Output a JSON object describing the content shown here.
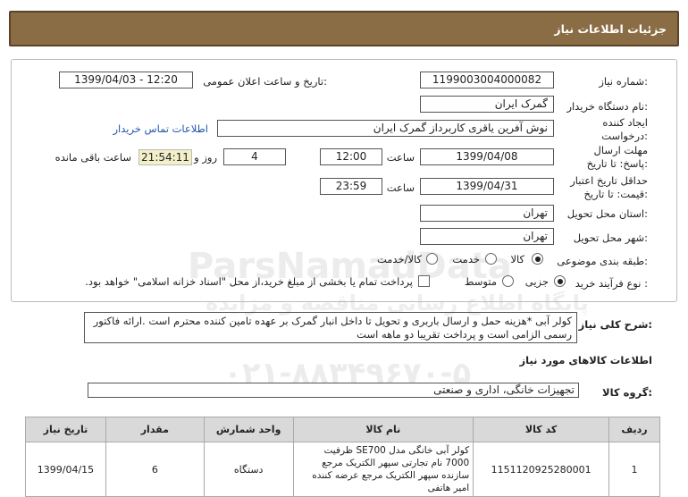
{
  "header": {
    "title": "جزئیات اطلاعات نیاز"
  },
  "fields": {
    "need_number_label": "شماره نیاز:",
    "need_number": "1199003004000082",
    "announce_label": "تاریخ و ساعت اعلان عمومی:",
    "announce_value": "1399/04/03 - 12:20",
    "buyer_label": "نام دستگاه خریدار:",
    "buyer": "گمرک ایران",
    "creator_label": "ایجاد کننده درخواست:",
    "creator": "نوش آفرین یاقری کاربرداز گمرک ایران",
    "contact_link": "اطلاعات تماس خریدار",
    "deadline_label": "مهلت ارسال پاسخ: تا تاریخ:",
    "deadline_date": "1399/04/08",
    "time_label": "ساعت",
    "deadline_time": "12:00",
    "days": "4",
    "days_label": "روز و",
    "remaining_time": "21:54:11",
    "remaining_label": "ساعت باقی مانده",
    "validity_label": "حداقل تاریخ اعتبار قیمت: تا تاریخ:",
    "validity_date": "1399/04/31",
    "validity_time": "23:59",
    "province_label": "استان محل تحویل:",
    "province": "تهران",
    "city_label": "شهر محل تحویل:",
    "city": "تهران",
    "category_label": "طبقه بندی موضوعی:",
    "cat_goods": "کالا",
    "cat_service": "خدمت",
    "cat_both": "کالا/خدمت",
    "process_label": "نوع فرآیند خرید :",
    "proc_small": "جزیی",
    "proc_medium": "متوسط",
    "payment_note": "پرداخت تمام یا بخشی از مبلغ خرید،از محل \"اسناد خزانه اسلامی\" خواهد بود."
  },
  "description": {
    "label": "شرح کلی نیاز:",
    "text": "کولر آبی *هزینه حمل و ارسال باربری و تحویل تا داخل انبار گمرک بر عهده تامین کننده محترم است .ارائه فاکتور رسمی الزامی است و پرداخت تقریبا دو ماهه است"
  },
  "goods": {
    "section_title": "اطلاعات کالاهای مورد نیاز",
    "group_label": "گروه کالا:",
    "group": "تجهیزات خانگی، اداری و صنعتی"
  },
  "table": {
    "headers": [
      "ردیف",
      "کد کالا",
      "نام کالا",
      "واحد شمارش",
      "مقدار",
      "تاریخ نیاز"
    ],
    "rows": [
      [
        "1",
        "1151120925280001",
        "کولر آبی خانگی مدل SE700 ظرفیت 7000 نام تجارتی سپهر الکتریک مرجع سازنده سپهر الکتریک مرجع عرضه کننده امیر هاتفی",
        "دستگاه",
        "6",
        "1399/04/15"
      ]
    ]
  },
  "watermark": {
    "brand": "ParsNamadData",
    "phone": "۰۲۱-۸۸۳۴۹۶۷۰-۵",
    "subtitle": "پایگاه اطلاع رسانی مناقصه و مزایده"
  }
}
